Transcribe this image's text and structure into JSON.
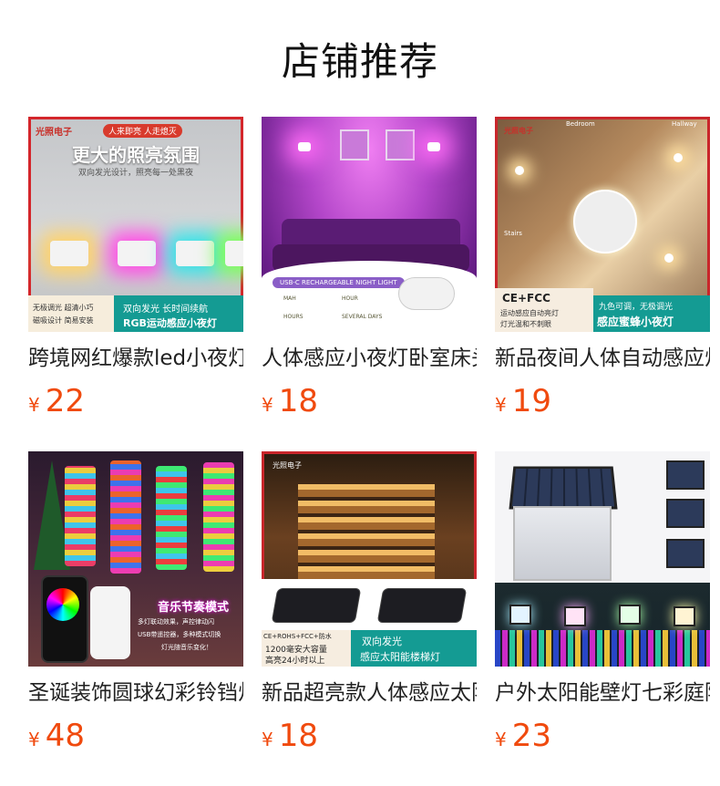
{
  "section_title": "店铺推荐",
  "products": [
    {
      "name": "跨境网红爆款led小夜灯",
      "currency": "¥",
      "price": "22",
      "image": {
        "brand": "光照电子",
        "tag": "人来即亮 人走熄灭",
        "headline": "更大的照亮氛围",
        "subline": "双向发光设计，照亮每一处黑夜",
        "left_badge_1": "无极调光 超清小巧",
        "left_badge_2": "磁吸设计 简易安装",
        "right_badge_1": "双向发光 长时间续航",
        "right_badge_2": "RGB运动感应小夜灯"
      }
    },
    {
      "name": "人体感应小夜灯卧室床头",
      "currency": "¥",
      "price": "18",
      "image": {
        "banner": "USB-C RECHARGEABLE NIGHT LIGHT",
        "spec_1": "MAH",
        "spec_2": "HOUR",
        "spec_3": "HOURS",
        "spec_4": "SEVERAL DAYS"
      }
    },
    {
      "name": "新品夜间人体自动感应灯",
      "currency": "¥",
      "price": "19",
      "image": {
        "brand": "光照电子",
        "label_bedroom": "Bedroom",
        "label_hallway": "Hallway",
        "label_stairs": "Stairs",
        "cert": "CE+FCC",
        "left_1": "运动感应自动亮灯",
        "left_2": "灯光温和不刺眼",
        "right_1": "九色可调，无极调光",
        "right_2": "感应蜜蜂小夜灯"
      }
    },
    {
      "name": "圣诞装饰圆球幻彩铃铛灯",
      "currency": "¥",
      "price": "48",
      "image": {
        "mode": "音乐节奏模式",
        "desc_1": "多灯联动效果，声控律动闪",
        "desc_2": "USB带遥控器，多种模式切换",
        "desc_3": "灯光随音乐变化！"
      }
    },
    {
      "name": "新品超亮款人体感应太阳能灯",
      "currency": "¥",
      "price": "18",
      "image": {
        "brand": "光照电子",
        "cert": "CE+ROHS+FCC+防水",
        "capacity": "1200毫安大容量",
        "duration": "高亮24小时以上",
        "right_1": "双向发光",
        "right_2": "感应太阳能楼梯灯"
      }
    },
    {
      "name": "户外太阳能壁灯七彩庭院灯",
      "currency": "¥",
      "price": "23",
      "image": {}
    }
  ]
}
